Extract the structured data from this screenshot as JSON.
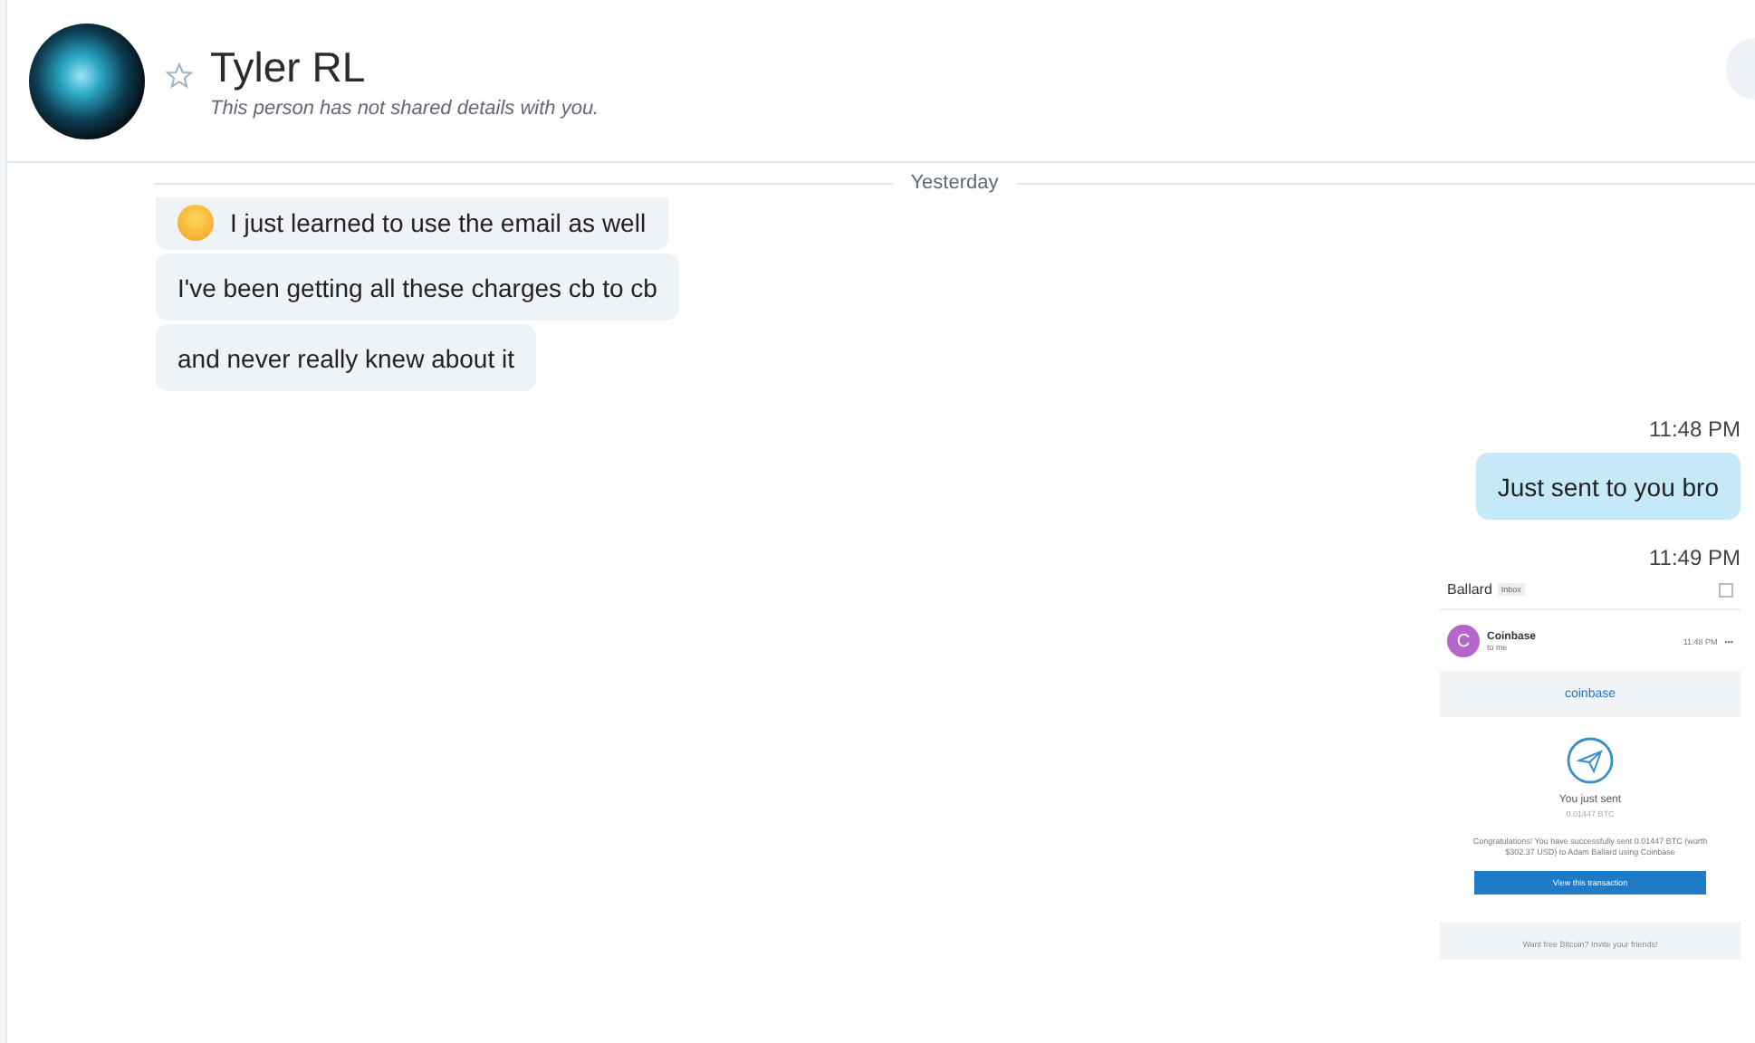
{
  "header": {
    "name": "Tyler RL",
    "subtitle": "This person has not shared details with you."
  },
  "divider": {
    "label": "Yesterday"
  },
  "messages": [
    {
      "kind": "text",
      "outgoing": false,
      "emoji": true,
      "text": "I just learned to use the email as well"
    },
    {
      "kind": "text",
      "outgoing": false,
      "emoji": false,
      "text": "I've been getting all these charges cb to cb"
    },
    {
      "kind": "text",
      "outgoing": false,
      "emoji": false,
      "text": "and never really knew about it"
    },
    {
      "kind": "time",
      "text": "11:48 PM"
    },
    {
      "kind": "text",
      "outgoing": true,
      "emoji": false,
      "text": "Just sent to you bro"
    },
    {
      "kind": "time",
      "text": "11:49 PM"
    },
    {
      "kind": "image",
      "outgoing": true,
      "email": {
        "sender_line": "Ballard",
        "folder": "Inbox",
        "from": "Coinbase",
        "avatar_letter": "C",
        "to": "to me",
        "time": "11:48 PM",
        "more": "•••",
        "brand": "coinbase",
        "headline": "You just sent",
        "amount": "0.01447 BTC",
        "body": "Congratulations! You have successfully sent 0.01447 BTC (worth $302.37 USD) to Adam Ballard using Coinbase",
        "button": "View this transaction",
        "footer": "Want free Bitcoin? Invite your friends!"
      }
    }
  ]
}
